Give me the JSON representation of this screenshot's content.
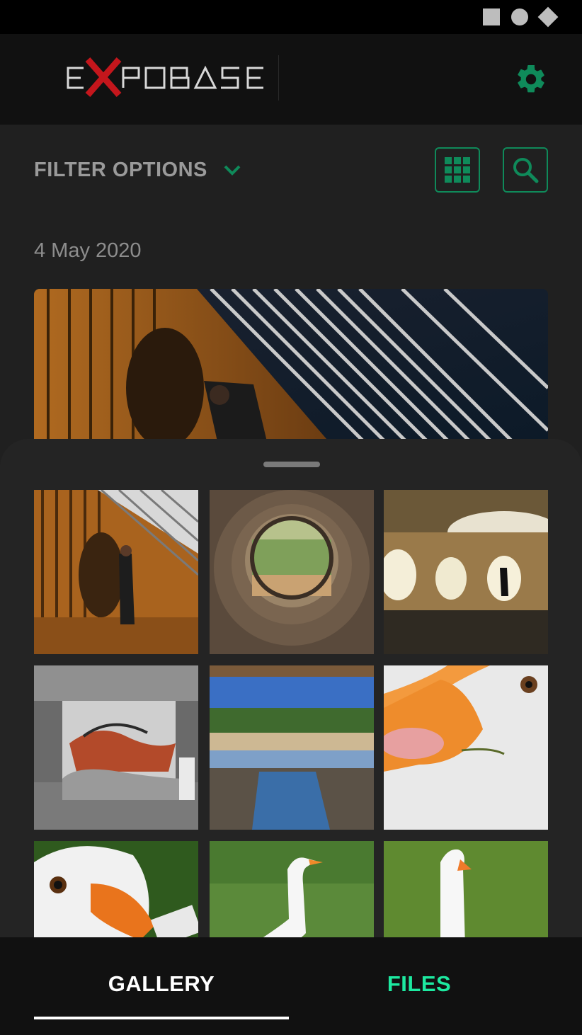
{
  "status_bar": {
    "icons": [
      "square-icon",
      "circle-icon",
      "diamond-icon"
    ]
  },
  "header": {
    "logo_text": "EXPOBASE",
    "settings_icon": "gear-icon",
    "accent_color": "#0f8a5a"
  },
  "filter": {
    "label": "FILTER OPTIONS",
    "expand_icon": "chevron-down-icon",
    "grid_view_icon": "grid-icon",
    "search_icon": "search-icon"
  },
  "section": {
    "date": "4 May 2020"
  },
  "gallery": {
    "photos": [
      "Person under steel lattice bridge",
      "Round concrete culvert looking out",
      "Concrete chamber with round openings",
      "Graffiti in concrete room",
      "Creek under bridge",
      "Goose close-up",
      "Goose head",
      "White goose in field",
      "White goose on grass"
    ]
  },
  "bottom_nav": {
    "tabs": [
      {
        "label": "GALLERY",
        "active": true
      },
      {
        "label": "FILES",
        "active": false
      }
    ],
    "active_color": "#ffffff",
    "inactive_color": "#1de9a0"
  }
}
